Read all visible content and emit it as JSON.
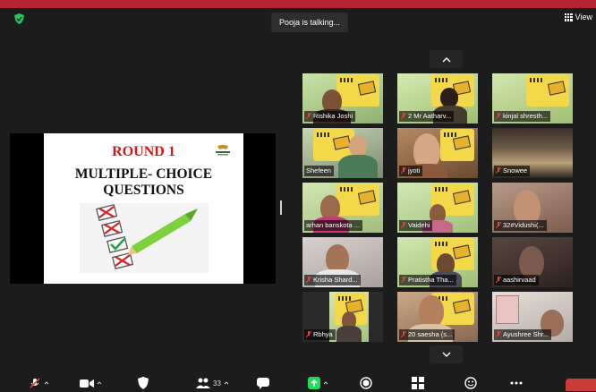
{
  "meeting": {
    "talking_indicator": "Pooja is talking...",
    "view_label": "View"
  },
  "slide": {
    "title": "ROUND 1",
    "heading_line1": "MULTIPLE- CHOICE",
    "heading_line2": "QUESTIONS"
  },
  "participants": [
    {
      "name": "Rishika Joshi",
      "muted": true
    },
    {
      "name": "2 Mr Aatharv...",
      "muted": true
    },
    {
      "name": "kinjal shresth...",
      "muted": true
    },
    {
      "name": "Shefeen",
      "muted": false
    },
    {
      "name": "jyoti",
      "muted": true
    },
    {
      "name": "Snowee",
      "muted": true
    },
    {
      "name": "arhan banskota ...",
      "muted": false
    },
    {
      "name": "Vaidehi",
      "muted": true
    },
    {
      "name": "32#Vidushi(...",
      "muted": true
    },
    {
      "name": "Krisha Shard...",
      "muted": true
    },
    {
      "name": "Pratistha Tha...",
      "muted": true
    },
    {
      "name": "aashirvaad",
      "muted": true
    },
    {
      "name": "Rbhya",
      "muted": true
    },
    {
      "name": "20 saesha (s...",
      "muted": true
    },
    {
      "name": "Ayushree Shr...",
      "muted": true
    }
  ],
  "toolbar": {
    "participants_count": "33"
  },
  "colors": {
    "accent_red": "#b4242f",
    "share_green": "#23d959",
    "mute_red": "#e0433c"
  },
  "icons": {
    "security": "shield-icon",
    "view": "grid-icon",
    "scroll_up": "chevron-up-icon",
    "scroll_down": "chevron-down-icon"
  }
}
